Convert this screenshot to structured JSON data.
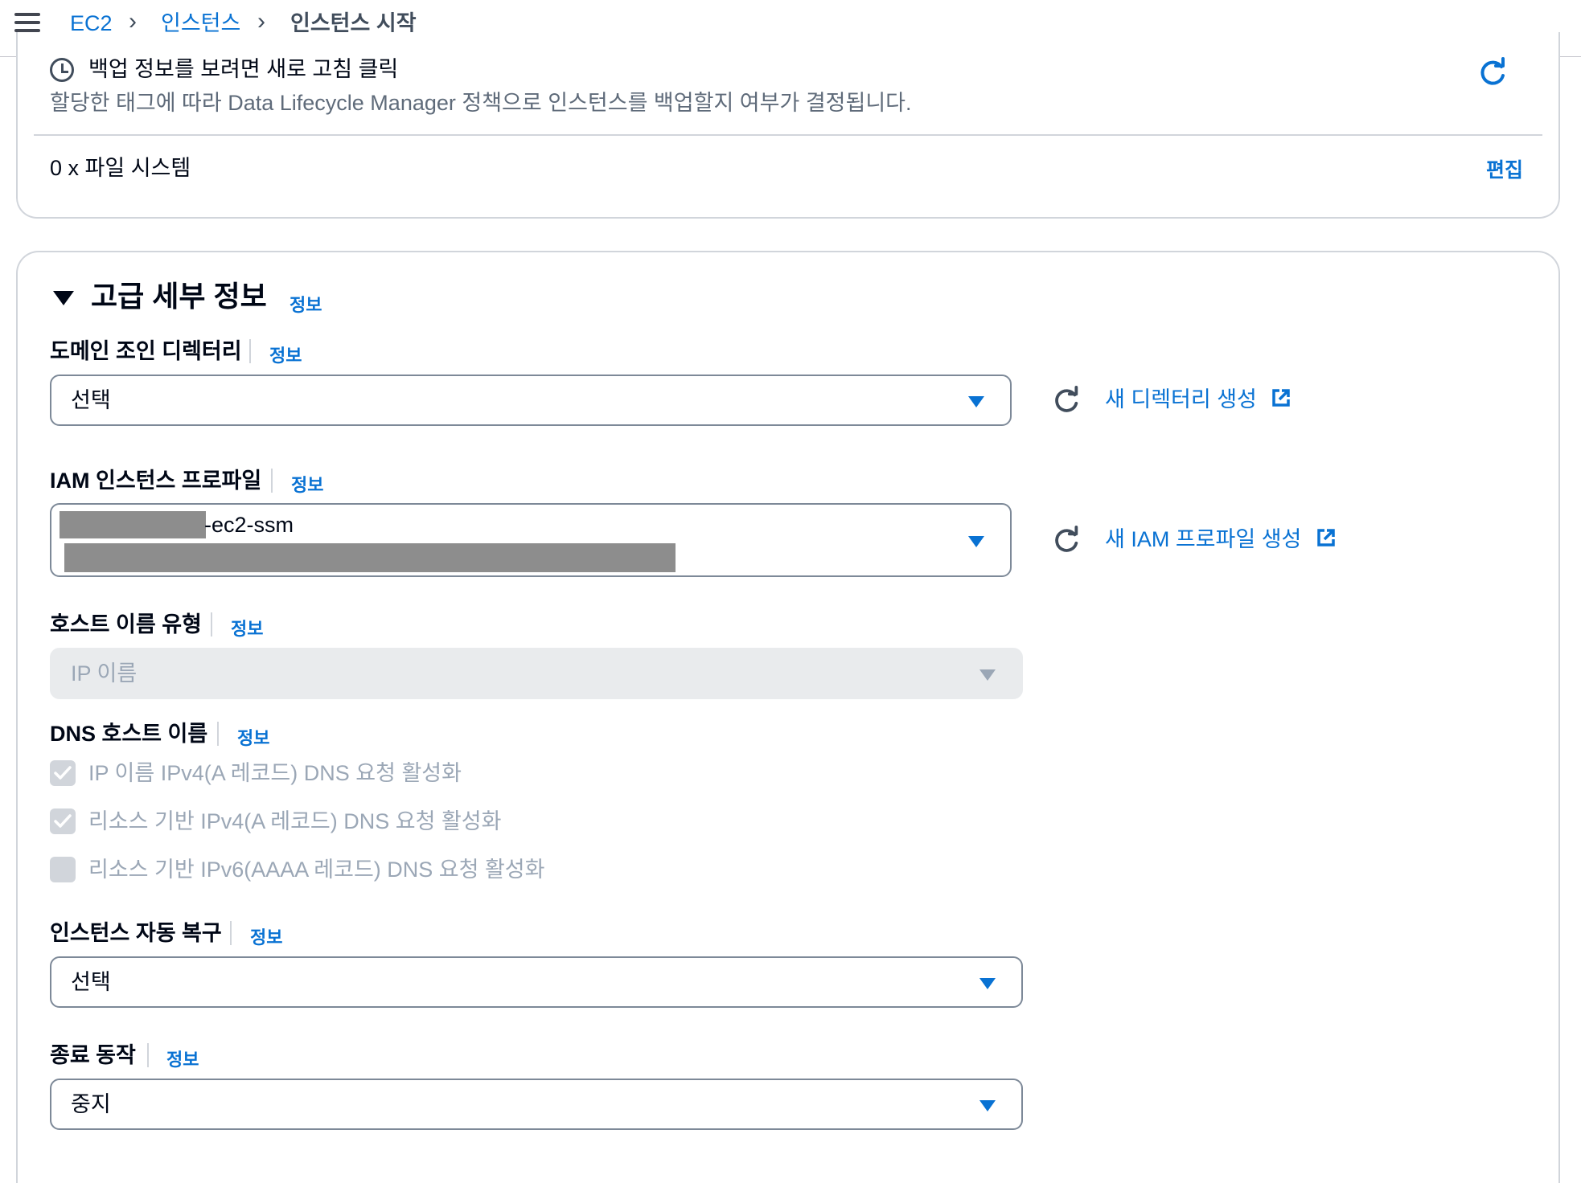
{
  "breadcrumb": {
    "items": [
      "EC2",
      "인스턴스"
    ],
    "current": "인스턴스 시작"
  },
  "backup": {
    "title": "백업 정보를 보려면 새로 고침 클릭",
    "description": "할당한 태그에 따라 Data Lifecycle Manager 정책으로 인스턴스를 백업할지 여부가 결정됩니다."
  },
  "filesystems": {
    "count_text": "0 x 파일 시스템",
    "edit_label": "편집"
  },
  "advanced": {
    "title": "고급 세부 정보",
    "info_label": "정보",
    "domain_join": {
      "label": "도메인 조인 디렉터리",
      "info": "정보",
      "value": "선택",
      "create_link": "새 디렉터리 생성"
    },
    "iam_profile": {
      "label": "IAM 인스턴스 프로파일",
      "info": "정보",
      "value_suffix": "-ec2-ssm",
      "create_link": "새 IAM 프로파일 생성"
    },
    "hostname_type": {
      "label": "호스트 이름 유형",
      "info": "정보",
      "value": "IP 이름"
    },
    "dns_hostname": {
      "label": "DNS 호스트 이름",
      "info": "정보",
      "options": [
        {
          "label": "IP 이름 IPv4(A 레코드) DNS 요청 활성화",
          "checked": true
        },
        {
          "label": "리소스 기반 IPv4(A 레코드) DNS 요청 활성화",
          "checked": true
        },
        {
          "label": "리소스 기반 IPv6(AAAA 레코드) DNS 요청 활성화",
          "checked": false
        }
      ]
    },
    "auto_recovery": {
      "label": "인스턴스 자동 복구",
      "info": "정보",
      "value": "선택"
    },
    "shutdown_behavior": {
      "label": "종료 동작",
      "info": "정보",
      "value": "중지"
    }
  },
  "colors": {
    "link": "#0972d3",
    "text": "#000716",
    "disabled_text": "#9ba7b6",
    "border": "#7d8998"
  }
}
